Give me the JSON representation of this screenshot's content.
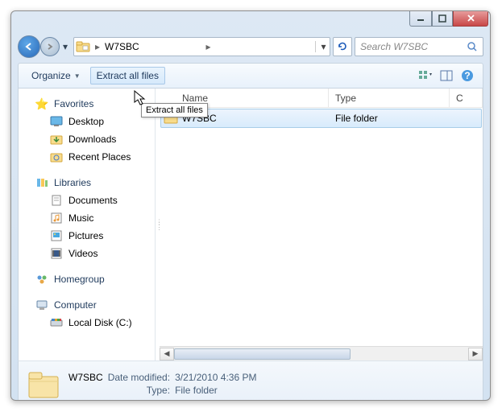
{
  "titlebar": {},
  "address": {
    "folder_name": "W7SBC",
    "search_placeholder": "Search W7SBC"
  },
  "toolbar": {
    "organize_label": "Organize",
    "extract_label": "Extract all files",
    "tooltip": "Extract all files"
  },
  "sidebar": {
    "favorites": {
      "label": "Favorites",
      "items": [
        {
          "label": "Desktop"
        },
        {
          "label": "Downloads"
        },
        {
          "label": "Recent Places"
        }
      ]
    },
    "libraries": {
      "label": "Libraries",
      "items": [
        {
          "label": "Documents"
        },
        {
          "label": "Music"
        },
        {
          "label": "Pictures"
        },
        {
          "label": "Videos"
        }
      ]
    },
    "homegroup": {
      "label": "Homegroup"
    },
    "computer": {
      "label": "Computer",
      "items": [
        {
          "label": "Local Disk (C:)"
        }
      ]
    }
  },
  "columns": {
    "name": "Name",
    "type": "Type",
    "compressed": "C"
  },
  "files": [
    {
      "name": "W7SBC",
      "type": "File folder"
    }
  ],
  "details": {
    "name": "W7SBC",
    "date_label": "Date modified:",
    "date_value": "3/21/2010 4:36 PM",
    "type_label": "Type:",
    "type_value": "File folder"
  }
}
